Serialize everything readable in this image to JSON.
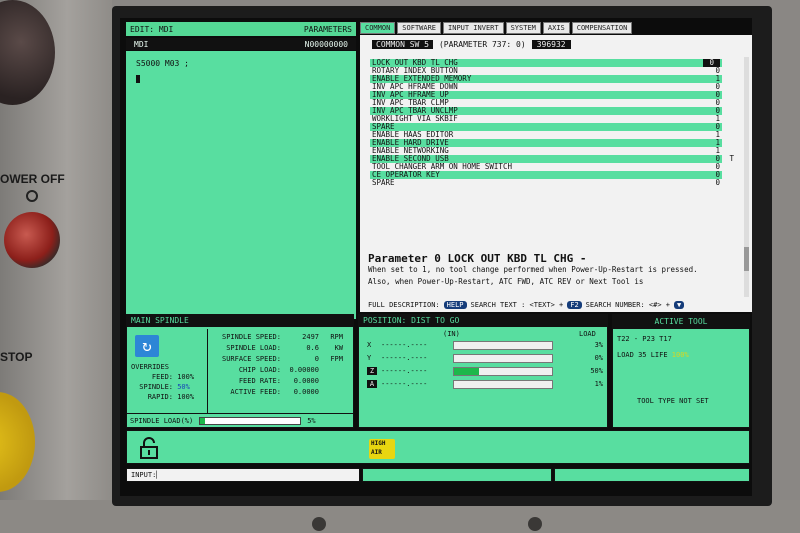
{
  "machine": {
    "power_off_label": "OWER OFF",
    "stop_label": "STOP"
  },
  "mdi": {
    "mode_label": "EDIT: MDI",
    "panel_label": "PARAMETERS",
    "program_label": "MDI",
    "program_number": "N00000000",
    "code_line": "S5000 M03 ;"
  },
  "tabs": [
    "COMMON",
    "SOFTWARE",
    "INPUT INVERT",
    "SYSTEM",
    "AXIS",
    "COMPENSATION"
  ],
  "params": {
    "header_box": "COMMON SW 5",
    "header_param": "(PARAMETER  737: 0)",
    "header_value": "396932",
    "rows": [
      {
        "label": "LOCK OUT KBD TL CHG",
        "value": "0",
        "hl": true,
        "sel": true
      },
      {
        "label": "ROTARY INDEX BUTTON",
        "value": "0",
        "hl": false
      },
      {
        "label": "ENABLE EXTENDED MEMORY",
        "value": "1",
        "hl": true
      },
      {
        "label": "INV APC HFRAME DOWN",
        "value": "0",
        "hl": false
      },
      {
        "label": "INV APC HFRAME UP",
        "value": "0",
        "hl": true
      },
      {
        "label": "INV APC TBAR CLMP",
        "value": "0",
        "hl": false
      },
      {
        "label": "INV APC TBAR UNCLMP",
        "value": "0",
        "hl": true
      },
      {
        "label": "WORKLIGHT VIA SKBIF",
        "value": "1",
        "hl": false
      },
      {
        "label": "SPARE",
        "value": "0",
        "hl": true
      },
      {
        "label": "ENABLE HAAS EDITOR",
        "value": "1",
        "hl": false
      },
      {
        "label": "ENABLE HARD DRIVE",
        "value": "1",
        "hl": true
      },
      {
        "label": "ENABLE NETWORKING",
        "value": "1",
        "hl": false
      },
      {
        "label": "ENABLE SECOND USB",
        "value": "0",
        "hl": true,
        "mark": "T"
      },
      {
        "label": "TOOL CHANGER ARM ON HOME SWITCH",
        "value": "0",
        "hl": false
      },
      {
        "label": "CE OPERATOR KEY",
        "value": "0",
        "hl": true
      },
      {
        "label": "SPARE",
        "value": "0",
        "hl": false
      }
    ],
    "title": "Parameter 0 LOCK OUT KBD TL CHG -",
    "description": "When set to 1, no tool change performed when Power-Up-Restart is pressed. Also, when Power-Up-Restart, ATC FWD, ATC REV or Next Tool is"
  },
  "help": {
    "full_desc": "FULL DESCRIPTION:",
    "help_key": "HELP",
    "search_text": "SEARCH TEXT : <TEXT> +",
    "f2_key": "F2",
    "search_number": "SEARCH NUMBER: <#> +",
    "down_key": "▼"
  },
  "spindle": {
    "title": "MAIN SPINDLE",
    "overrides_label": "OVERRIDES",
    "feed_label": "FEED:",
    "feed_val": "100%",
    "spindle_label": "SPINDLE:",
    "spindle_val": "50%",
    "rapid_label": "RAPID:",
    "rapid_val": "100%",
    "rows": [
      {
        "label": "SPINDLE SPEED:",
        "value": "2497",
        "unit": "RPM"
      },
      {
        "label": "SPINDLE LOAD:",
        "value": "0.6",
        "unit": "KW"
      },
      {
        "label": "SURFACE SPEED:",
        "value": "0",
        "unit": "FPM"
      },
      {
        "label": "CHIP LOAD:",
        "value": "0.00000",
        "unit": ""
      },
      {
        "label": "FEED RATE:",
        "value": "0.0000",
        "unit": ""
      },
      {
        "label": "ACTIVE FEED:",
        "value": "0.0000",
        "unit": ""
      }
    ],
    "load_label": "SPINDLE LOAD(%)",
    "load_value": "5%",
    "load_fraction": 0.05
  },
  "position": {
    "title": "POSITION: DIST TO GO",
    "units": "(IN)",
    "load_header": "LOAD",
    "axes": [
      {
        "name": "X",
        "value": "------.----",
        "load": "3%",
        "fill": 0.0,
        "sel": false
      },
      {
        "name": "Y",
        "value": "------.----",
        "load": "0%",
        "fill": 0.0,
        "sel": false
      },
      {
        "name": "Z",
        "value": "------.----",
        "load": "50%",
        "fill": 0.25,
        "sel": true
      },
      {
        "name": "A",
        "value": "------.----",
        "load": "1%",
        "fill": 0.0,
        "sel": true
      }
    ]
  },
  "tool": {
    "title": "ACTIVE TOOL",
    "line1": "T22  - P23  T17",
    "load_label": "LOAD 35 LIFE",
    "life_value": "100%",
    "status": "TOOL TYPE NOT SET"
  },
  "status": {
    "high_air_1": "HIGH",
    "high_air_2": "AIR"
  },
  "input": {
    "label": "INPUT:"
  }
}
